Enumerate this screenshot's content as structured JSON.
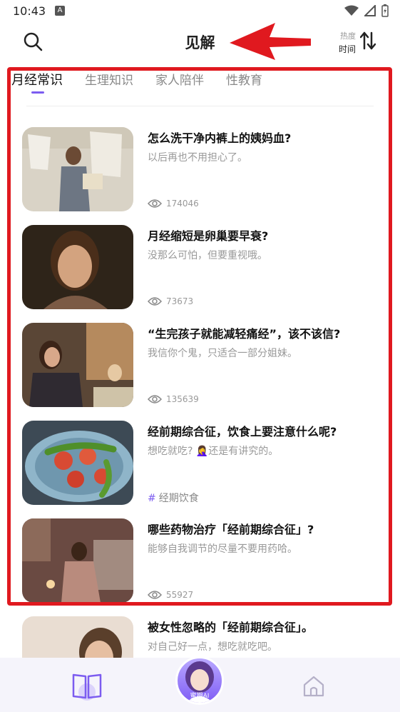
{
  "status": {
    "time": "10:43",
    "notif": "A"
  },
  "header": {
    "title": "见解",
    "sort_top": "热度",
    "sort_bottom": "时间"
  },
  "tabs": [
    {
      "label": "月经常识",
      "active": true
    },
    {
      "label": "生理知识"
    },
    {
      "label": "家人陪伴"
    },
    {
      "label": "性教育"
    }
  ],
  "articles": [
    {
      "title": "怎么洗干净内裤上的姨妈血?",
      "subtitle": "以后再也不用担心了。",
      "views": "174046"
    },
    {
      "title": "月经缩短是卵巢要早衰?",
      "subtitle": "没那么可怕，但要重视哦。",
      "views": "73673"
    },
    {
      "title": "“生完孩子就能减轻痛经”，该不该信?",
      "subtitle": "我信你个鬼，只适合一部分姐妹。",
      "views": "135639"
    },
    {
      "title": "经前期综合征，饮食上要注意什么呢?",
      "subtitle": "想吃就吃? 🤦‍♀️还是有讲究的。",
      "tag": "经期饮食"
    },
    {
      "title": "哪些药物治疗「经前期综合征」?",
      "subtitle": "能够自我调节的尽量不要用药哈。",
      "views": "55927"
    },
    {
      "title": "被女性忽略的「经前期综合征」。",
      "subtitle": "对自己好一点，想吃就吃吧。"
    }
  ],
  "bottom_nav": {
    "center_label": "蜜期AI"
  },
  "colors": {
    "accent": "#7c5cf0",
    "highlight": "#e0191f"
  }
}
